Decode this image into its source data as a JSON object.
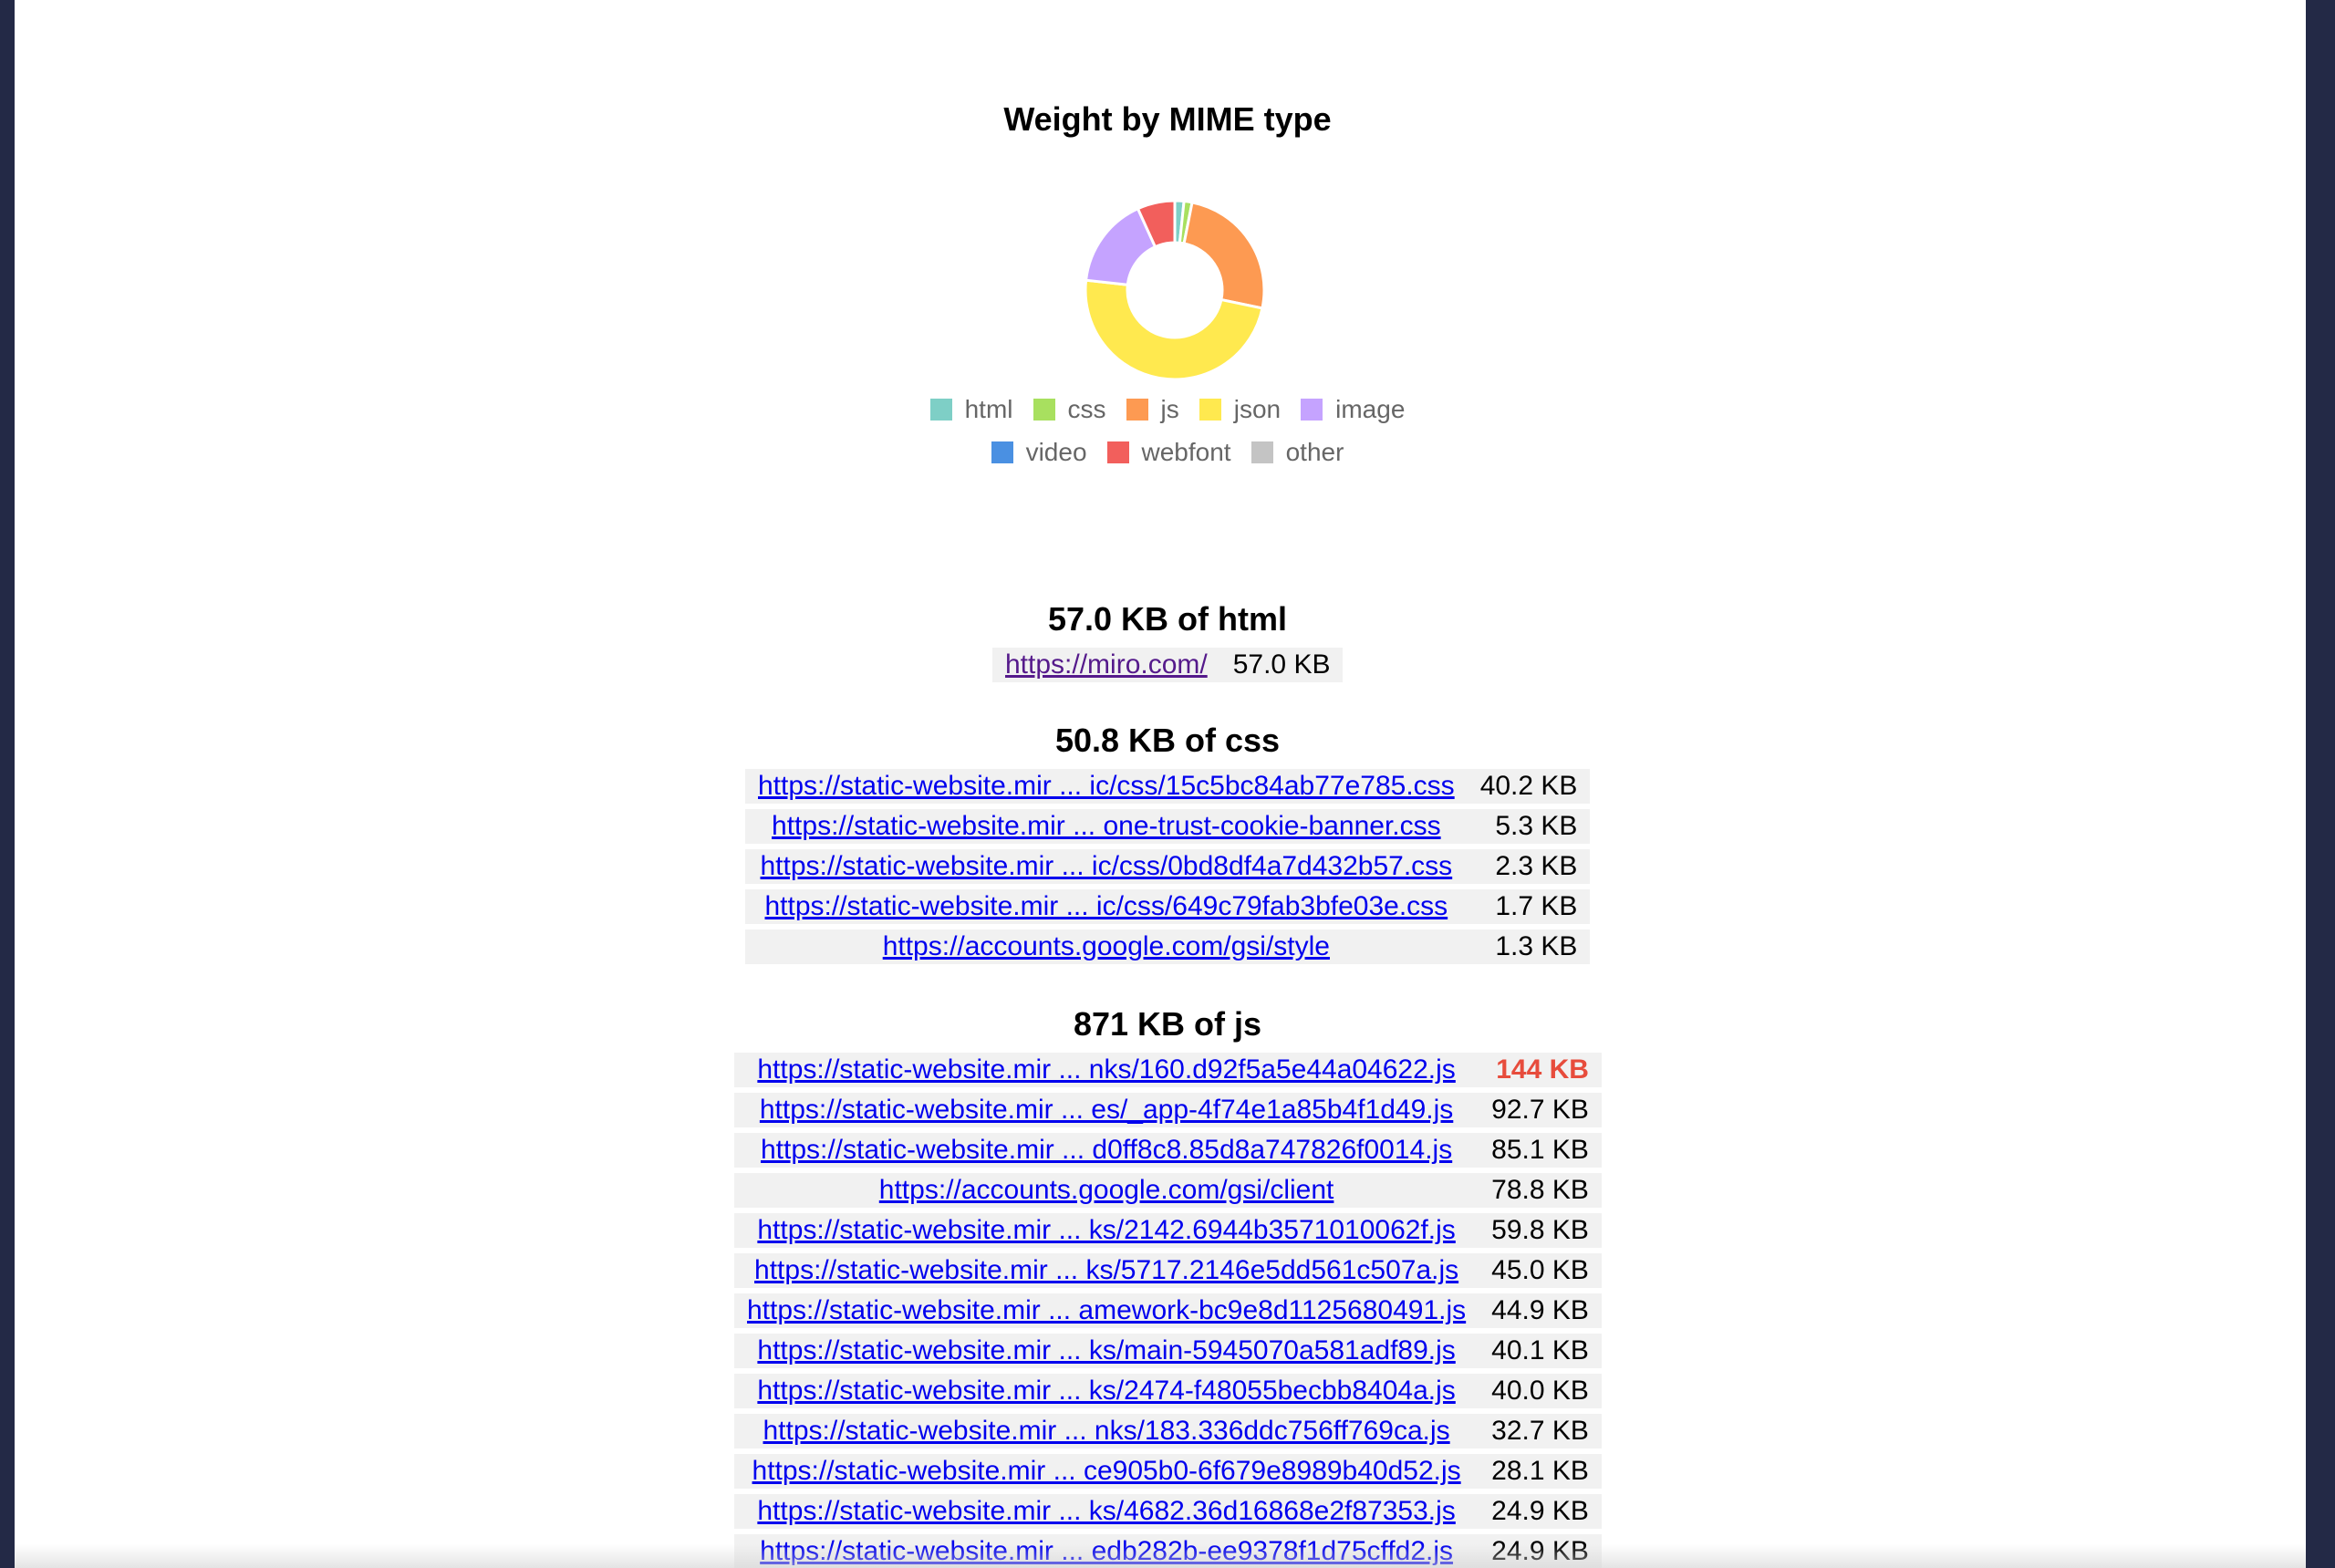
{
  "chart_data": {
    "type": "pie",
    "title": "Weight by MIME type",
    "categories": [
      "html",
      "css",
      "js",
      "json",
      "image",
      "video",
      "webfont",
      "other"
    ],
    "values": [
      57.0,
      50.8,
      871,
      1680,
      570,
      0,
      235,
      0
    ],
    "colors": [
      "#7ecfc6",
      "#a8e05f",
      "#fd9a52",
      "#ffe94f",
      "#c5a3ff",
      "#4a90e2",
      "#f25f5c",
      "#c4c4c4"
    ],
    "donut": true,
    "legend": "bottom"
  },
  "legend": {
    "row1": [
      {
        "label": "html",
        "color": "#7ecfc6"
      },
      {
        "label": "css",
        "color": "#a8e05f"
      },
      {
        "label": "js",
        "color": "#fd9a52"
      },
      {
        "label": "json",
        "color": "#ffe94f"
      },
      {
        "label": "image",
        "color": "#c5a3ff"
      }
    ],
    "row2": [
      {
        "label": "video",
        "color": "#4a90e2"
      },
      {
        "label": "webfont",
        "color": "#f25f5c"
      },
      {
        "label": "other",
        "color": "#c4c4c4"
      }
    ]
  },
  "sections": {
    "html": {
      "title": "57.0 KB of html",
      "rows": [
        {
          "url": "https://miro.com/",
          "size": "57.0 KB"
        }
      ]
    },
    "css": {
      "title": "50.8 KB of css",
      "rows": [
        {
          "url": "https://static-website.mir ... ic/css/15c5bc84ab77e785.css",
          "size": "40.2 KB"
        },
        {
          "url": "https://static-website.mir ... one-trust-cookie-banner.css",
          "size": "5.3 KB"
        },
        {
          "url": "https://static-website.mir ... ic/css/0bd8df4a7d432b57.css",
          "size": "2.3 KB"
        },
        {
          "url": "https://static-website.mir ... ic/css/649c79fab3bfe03e.css",
          "size": "1.7 KB"
        },
        {
          "url": "https://accounts.google.com/gsi/style",
          "size": "1.3 KB"
        }
      ]
    },
    "js": {
      "title": "871 KB of js",
      "rows": [
        {
          "url": "https://static-website.mir ... nks/160.d92f5a5e44a04622.js",
          "size": "144 KB"
        },
        {
          "url": "https://static-website.mir ... es/_app-4f74e1a85b4f1d49.js",
          "size": "92.7 KB"
        },
        {
          "url": "https://static-website.mir ... d0ff8c8.85d8a747826f0014.js",
          "size": "85.1 KB"
        },
        {
          "url": "https://accounts.google.com/gsi/client",
          "size": "78.8 KB"
        },
        {
          "url": "https://static-website.mir ... ks/2142.6944b3571010062f.js",
          "size": "59.8 KB"
        },
        {
          "url": "https://static-website.mir ... ks/5717.2146e5dd561c507a.js",
          "size": "45.0 KB"
        },
        {
          "url": "https://static-website.mir ... amework-bc9e8d1125680491.js",
          "size": "44.9 KB"
        },
        {
          "url": "https://static-website.mir ... ks/main-5945070a581adf89.js",
          "size": "40.1 KB"
        },
        {
          "url": "https://static-website.mir ... ks/2474-f48055becbb8404a.js",
          "size": "40.0 KB"
        },
        {
          "url": "https://static-website.mir ... nks/183.336ddc756ff769ca.js",
          "size": "32.7 KB"
        },
        {
          "url": "https://static-website.mir ... ce905b0-6f679e8989b40d52.js",
          "size": "28.1 KB"
        },
        {
          "url": "https://static-website.mir ... ks/4682.36d16868e2f87353.js",
          "size": "24.9 KB"
        },
        {
          "url": "https://static-website.mir ... edb282b-ee9378f1d75cffd2.js",
          "size": "24.9 KB"
        }
      ]
    }
  }
}
